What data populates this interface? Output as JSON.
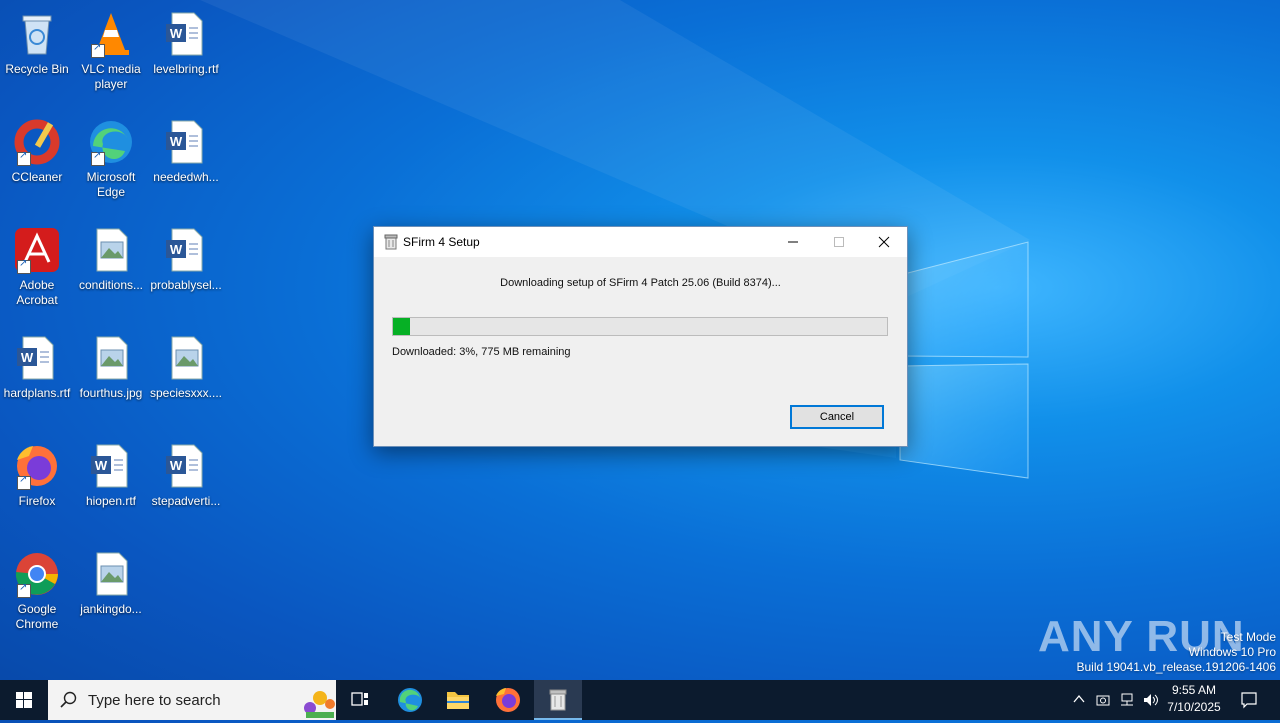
{
  "desktop": {
    "icons": [
      {
        "label": "Recycle Bin",
        "icon": "recycle-bin-icon"
      },
      {
        "label": "VLC media player",
        "icon": "vlc-icon"
      },
      {
        "label": "levelbring.rtf",
        "icon": "word-document-icon"
      },
      {
        "label": "CCleaner",
        "icon": "ccleaner-icon"
      },
      {
        "label": "Microsoft Edge",
        "icon": "edge-icon"
      },
      {
        "label": "neededwh...",
        "icon": "word-document-icon"
      },
      {
        "label": "Adobe Acrobat",
        "icon": "acrobat-icon"
      },
      {
        "label": "conditions...",
        "icon": "image-file-icon"
      },
      {
        "label": "probablysel...",
        "icon": "word-document-icon"
      },
      {
        "label": "hardplans.rtf",
        "icon": "word-document-icon"
      },
      {
        "label": "fourthus.jpg",
        "icon": "image-file-icon"
      },
      {
        "label": "speciesxxx....",
        "icon": "image-file-icon"
      },
      {
        "label": "Firefox",
        "icon": "firefox-icon"
      },
      {
        "label": "hiopen.rtf",
        "icon": "word-document-icon"
      },
      {
        "label": "stepadverti...",
        "icon": "word-document-icon"
      },
      {
        "label": "Google Chrome",
        "icon": "chrome-icon"
      },
      {
        "label": "jankingdo...",
        "icon": "image-file-icon"
      }
    ]
  },
  "dialog": {
    "title": "SFirm 4 Setup",
    "message": "Downloading setup of SFirm 4 Patch 25.06 (Build 8374)...",
    "progress_fraction": 0.035,
    "status": "Downloaded: 3%, 775 MB remaining",
    "cancel_label": "Cancel"
  },
  "watermark": {
    "brand": "ANY RUN",
    "line1": "Test Mode",
    "line2": "Windows 10 Pro",
    "line3": "Build 19041.vb_release.191206-1406"
  },
  "taskbar": {
    "search_placeholder": "Type here to search",
    "time": "9:55 AM",
    "date": "7/10/2025"
  },
  "colors": {
    "progress_fill": "#06b025",
    "accent": "#0078d7",
    "taskbar": "#0c1b2e"
  }
}
